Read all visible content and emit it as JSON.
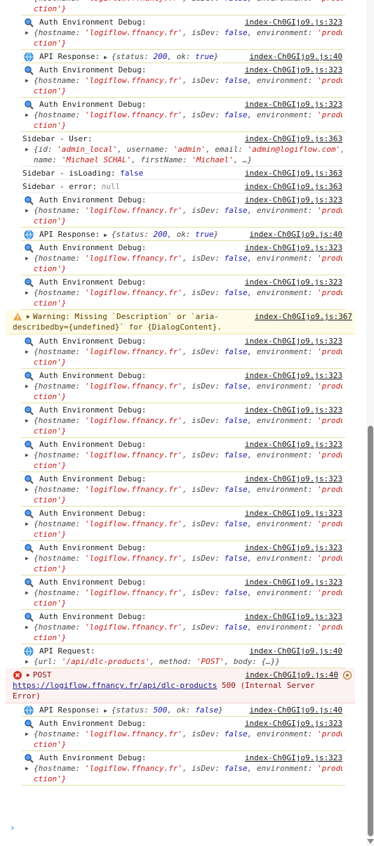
{
  "console": {
    "entries": [
      {
        "kind": "auth-top",
        "lbl": "",
        "src": "",
        "obj": "{hostname: 'logiflow.ffnancy.fr', isDev: false, environment: 'produ",
        "wrap": "ction'}"
      },
      {
        "kind": "auth",
        "lbl": "Auth Environment Debug:",
        "src": "index-Ch0GIjo9.js:323",
        "obj": "{hostname: 'logiflow.ffnancy.fr', isDev: false, environment: 'produ",
        "wrap": "ction'}"
      },
      {
        "kind": "api",
        "lbl": "API Response:",
        "src": "index-Ch0GIjo9.js:40",
        "obj": "{status: 200, ok: true}"
      },
      {
        "kind": "auth",
        "lbl": "Auth Environment Debug:",
        "src": "index-Ch0GIjo9.js:323",
        "obj": "{hostname: 'logiflow.ffnancy.fr', isDev: false, environment: 'produ",
        "wrap": "ction'}"
      },
      {
        "kind": "auth",
        "lbl": "Auth Environment Debug:",
        "src": "index-Ch0GIjo9.js:323",
        "obj": "{hostname: 'logiflow.ffnancy.fr', isDev: false, environment: 'produ",
        "wrap": "ction'}"
      },
      {
        "kind": "user",
        "lbl": "Sidebar - User:",
        "src": "index-Ch0GIjo9.js:363",
        "obj": "{id: 'admin_local', username: 'admin', email: 'admin@logiflow.com',",
        "wrap": "name: 'Michael SCHAL', firstName: 'Michael', …}"
      },
      {
        "kind": "simple",
        "lbl": "Sidebar - isLoading: ",
        "val": "false",
        "src": "index-Ch0GIjo9.js:363"
      },
      {
        "kind": "simple",
        "lbl": "Sidebar - error: ",
        "val": "null",
        "src": "index-Ch0GIjo9.js:363"
      },
      {
        "kind": "auth",
        "lbl": "Auth Environment Debug:",
        "src": "index-Ch0GIjo9.js:323",
        "obj": "{hostname: 'logiflow.ffnancy.fr', isDev: false, environment: 'produ",
        "wrap": "ction'}"
      },
      {
        "kind": "api",
        "lbl": "API Response:",
        "src": "index-Ch0GIjo9.js:40",
        "obj": "{status: 200, ok: true}"
      },
      {
        "kind": "auth",
        "lbl": "Auth Environment Debug:",
        "src": "index-Ch0GIjo9.js:323",
        "obj": "{hostname: 'logiflow.ffnancy.fr', isDev: false, environment: 'produ",
        "wrap": "ction'}"
      },
      {
        "kind": "auth",
        "lbl": "Auth Environment Debug:",
        "src": "index-Ch0GIjo9.js:323",
        "obj": "{hostname: 'logiflow.ffnancy.fr', isDev: false, environment: 'produ",
        "wrap": "ction'}"
      },
      {
        "kind": "warn",
        "lbl": "Warning: Missing `Description` or `aria-",
        "src": "index-Ch0GIjo9.js:367",
        "wrap": "describedby={undefined}` for {DialogContent}."
      },
      {
        "kind": "auth",
        "lbl": "Auth Environment Debug:",
        "src": "index-Ch0GIjo9.js:323",
        "obj": "{hostname: 'logiflow.ffnancy.fr', isDev: false, environment: 'produ",
        "wrap": "ction'}"
      },
      {
        "kind": "auth",
        "lbl": "Auth Environment Debug:",
        "src": "index-Ch0GIjo9.js:323",
        "obj": "{hostname: 'logiflow.ffnancy.fr', isDev: false, environment: 'produ",
        "wrap": "ction'}"
      },
      {
        "kind": "auth",
        "lbl": "Auth Environment Debug:",
        "src": "index-Ch0GIjo9.js:323",
        "obj": "{hostname: 'logiflow.ffnancy.fr', isDev: false, environment: 'produ",
        "wrap": "ction'}"
      },
      {
        "kind": "auth",
        "lbl": "Auth Environment Debug:",
        "src": "index-Ch0GIjo9.js:323",
        "obj": "{hostname: 'logiflow.ffnancy.fr', isDev: false, environment: 'produ",
        "wrap": "ction'}"
      },
      {
        "kind": "auth",
        "lbl": "Auth Environment Debug:",
        "src": "index-Ch0GIjo9.js:323",
        "obj": "{hostname: 'logiflow.ffnancy.fr', isDev: false, environment: 'produ",
        "wrap": "ction'}"
      },
      {
        "kind": "auth",
        "lbl": "Auth Environment Debug:",
        "src": "index-Ch0GIjo9.js:323",
        "obj": "{hostname: 'logiflow.ffnancy.fr', isDev: false, environment: 'produ",
        "wrap": "ction'}"
      },
      {
        "kind": "auth",
        "lbl": "Auth Environment Debug:",
        "src": "index-Ch0GIjo9.js:323",
        "obj": "{hostname: 'logiflow.ffnancy.fr', isDev: false, environment: 'produ",
        "wrap": "ction'}"
      },
      {
        "kind": "auth",
        "lbl": "Auth Environment Debug:",
        "src": "index-Ch0GIjo9.js:323",
        "obj": "{hostname: 'logiflow.ffnancy.fr', isDev: false, environment: 'produ",
        "wrap": "ction'}"
      },
      {
        "kind": "auth",
        "lbl": "Auth Environment Debug:",
        "src": "index-Ch0GIjo9.js:323",
        "obj": "{hostname: 'logiflow.ffnancy.fr', isDev: false, environment: 'produ",
        "wrap": "ction'}"
      },
      {
        "kind": "apireq",
        "lbl": "API Request:",
        "src": "index-Ch0GIjo9.js:40",
        "obj": "{url: '/api/dlc-products', method: 'POST', body: {…}}"
      },
      {
        "kind": "error",
        "lbl": "POST",
        "src": "index-Ch0GIjo9.js:40",
        "url": "https://logiflow.ffnancy.fr/api/dlc-products",
        "tail": " 500 (Internal Server",
        "wrap": "Error)"
      },
      {
        "kind": "api",
        "lbl": "API Response:",
        "src": "index-Ch0GIjo9.js:40",
        "obj": "{status: 500, ok: false}"
      },
      {
        "kind": "auth",
        "lbl": "Auth Environment Debug:",
        "src": "index-Ch0GIjo9.js:323",
        "obj": "{hostname: 'logiflow.ffnancy.fr', isDev: false, environment: 'produ",
        "wrap": "ction'}"
      },
      {
        "kind": "auth",
        "lbl": "Auth Environment Debug:",
        "src": "index-Ch0GIjo9.js:323",
        "obj": "{hostname: 'logiflow.ffnancy.fr', isDev: false, environment: 'produ",
        "wrap": "ction'}"
      }
    ],
    "prompt": "›",
    "colors": {
      "string": "#c41a16",
      "bool": "#1a1aa6",
      "warn_bg": "#fefbe6",
      "error_bg": "#fdf2f2"
    },
    "icons": {
      "auth": "magnifier-icon",
      "api": "globe-icon",
      "warn": "warning-icon",
      "error": "error-icon"
    }
  }
}
